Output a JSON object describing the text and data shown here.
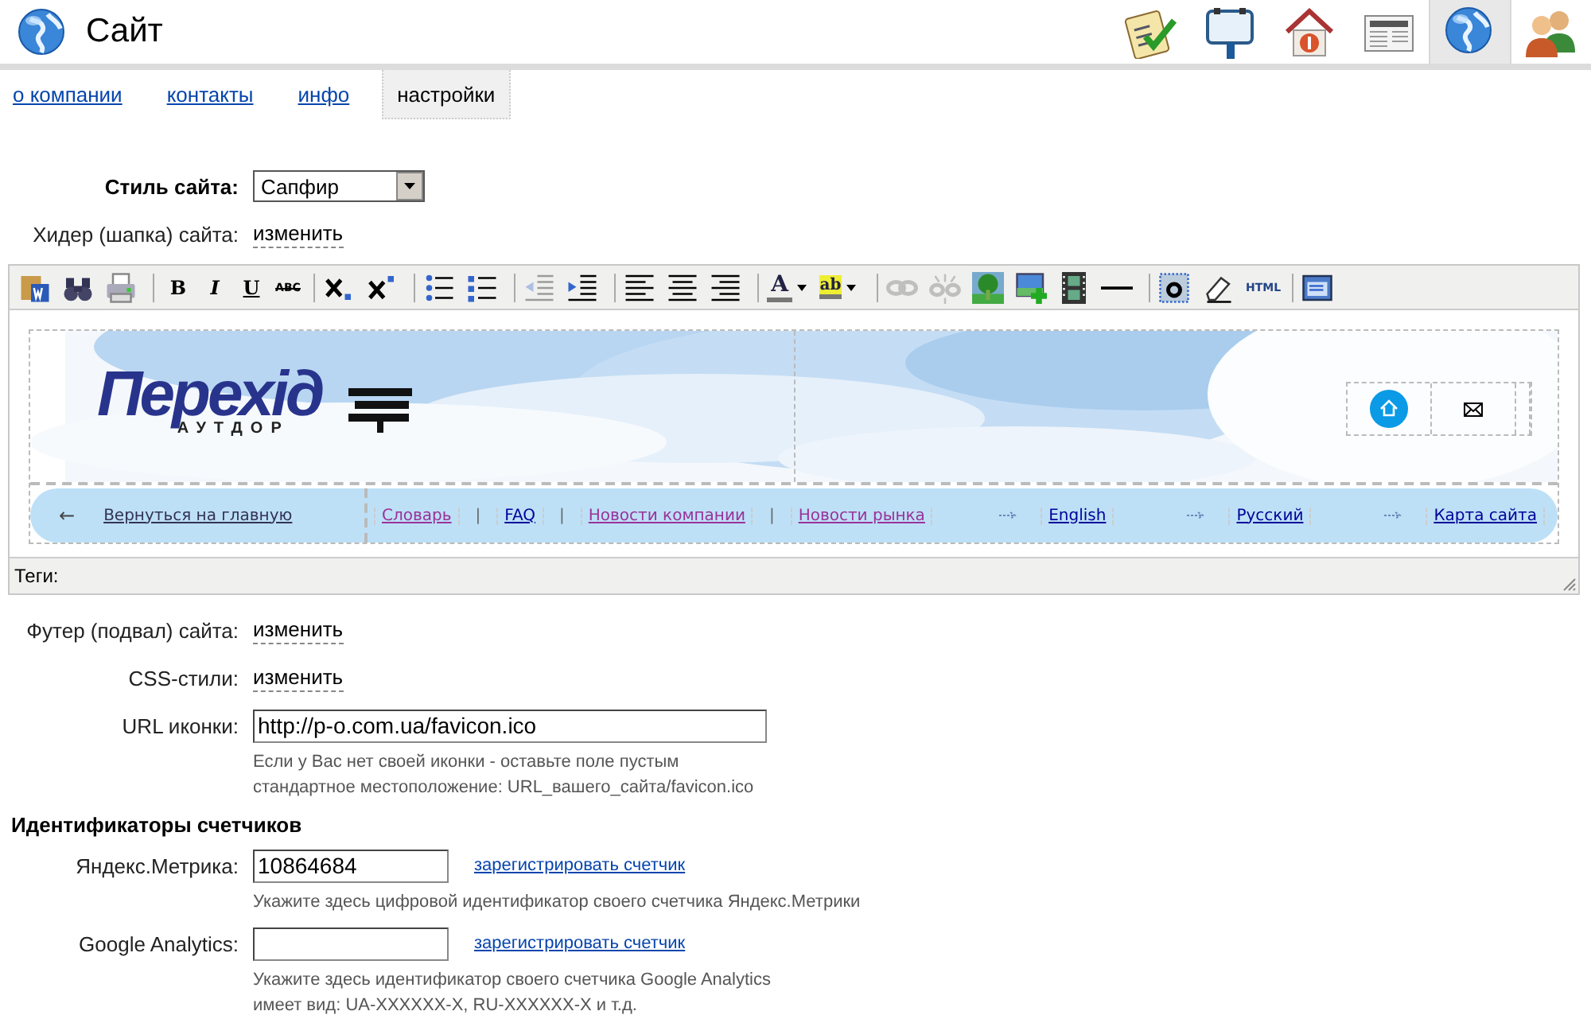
{
  "header": {
    "title": "Сайт"
  },
  "top_nav": [
    {
      "selected": false
    },
    {
      "selected": false
    },
    {
      "selected": false
    },
    {
      "selected": false
    },
    {
      "selected": true
    },
    {
      "selected": false
    }
  ],
  "tabs": [
    {
      "label": "о компании",
      "selected": false
    },
    {
      "label": "контакты",
      "selected": false
    },
    {
      "label": "инфо",
      "selected": false
    },
    {
      "label": "настройки",
      "selected": true
    }
  ],
  "style_row": {
    "label": "Стиль сайта:",
    "value": "Сапфир"
  },
  "header_row": {
    "label": "Хидер (шапка) сайта:",
    "link": "изменить"
  },
  "editor": {
    "toolbar": [
      [
        {
          "disabled": false
        },
        {
          "disabled": false
        },
        {
          "disabled": false
        }
      ],
      [
        {
          "disabled": false,
          "glyph": "B"
        },
        {
          "disabled": false,
          "glyph": "I"
        },
        {
          "disabled": false,
          "glyph": "U"
        },
        {
          "disabled": false,
          "glyph": "ABC"
        }
      ],
      [
        {
          "disabled": false
        },
        {
          "disabled": false
        }
      ],
      [
        {
          "disabled": false
        },
        {
          "disabled": false
        }
      ],
      [
        {
          "disabled": true
        },
        {
          "disabled": false
        }
      ],
      [
        {
          "disabled": false
        },
        {
          "disabled": false
        },
        {
          "disabled": false
        }
      ],
      [
        {
          "disabled": false,
          "glyph": "A",
          "menu": true
        },
        {
          "disabled": false,
          "glyph": "ab",
          "menu": true
        }
      ],
      [
        {
          "disabled": true
        },
        {
          "disabled": true
        },
        {
          "disabled": false
        },
        {
          "disabled": false
        },
        {
          "disabled": false
        },
        {
          "disabled": false
        }
      ],
      [
        {
          "disabled": false
        },
        {
          "disabled": false
        },
        {
          "disabled": false,
          "glyph": "HTML"
        }
      ],
      [
        {
          "disabled": false
        }
      ]
    ],
    "preview": {
      "logo": "Перехід",
      "logo_sub": "АУТДОР",
      "nav": [
        {
          "kind": "back",
          "arrow": "←",
          "label": "Вернуться на главную"
        },
        {
          "kind": "link",
          "label": "Словарь",
          "visited": true
        },
        {
          "kind": "sep",
          "text": "|"
        },
        {
          "kind": "link",
          "label": "FAQ",
          "visited": false
        },
        {
          "kind": "sep",
          "text": "|"
        },
        {
          "kind": "link",
          "label": "Новости компании",
          "visited": true
        },
        {
          "kind": "sep",
          "text": "|"
        },
        {
          "kind": "link",
          "label": "Новости рынка",
          "visited": true
        },
        {
          "kind": "arrow-link",
          "label": "English",
          "visited": false
        },
        {
          "kind": "arrow-link",
          "label": "Русский",
          "visited": false
        },
        {
          "kind": "arrow-link",
          "label": "Карта сайта",
          "visited": false
        }
      ]
    },
    "status": "Теги:"
  },
  "footer_row": {
    "label": "Футер (подвал) сайта:",
    "link": "изменить"
  },
  "css_row": {
    "label": "CSS-стили:",
    "link": "изменить"
  },
  "icon_row": {
    "label": "URL иконки:",
    "value": "http://p-o.com.ua/favicon.ico",
    "hints": [
      "Если у Вас нет своей иконки - оставьте поле пустым",
      "стандартное местоположение: URL_вашего_сайта/favicon.ico"
    ]
  },
  "counters": {
    "title": "Идентификаторы счетчиков",
    "rows": [
      {
        "label": "Яндекс.Метрика:",
        "value": "10864684",
        "link": "зарегистрировать счетчик",
        "hints": [
          "Укажите здесь цифровой идентификатор своего счетчика Яндекс.Метрики"
        ]
      },
      {
        "label": "Google Analytics:",
        "value": "",
        "link": "зарегистрировать счетчик",
        "hints": [
          "Укажите здесь идентификатор своего счетчика Google Analytics",
          "имеет вид: UA-XXXXXX-X, RU-XXXXXX-X и т.д."
        ]
      }
    ]
  }
}
